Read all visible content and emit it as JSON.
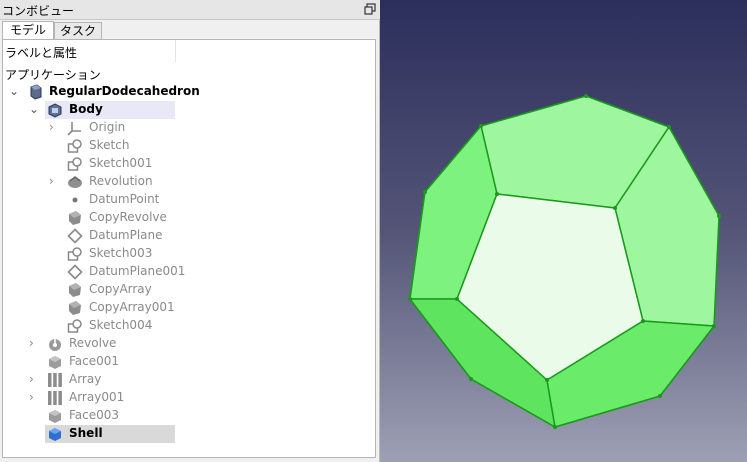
{
  "combo": {
    "title": "コンボビュー",
    "tabs": [
      {
        "label": "モデル"
      },
      {
        "label": "タスク"
      }
    ],
    "labels_header": "ラベルと属性",
    "app_header": "アプリケーション"
  },
  "tree": {
    "root": {
      "label": "RegularDodecahedron"
    },
    "items": [
      {
        "label": "Body"
      },
      {
        "label": "Origin"
      },
      {
        "label": "Sketch"
      },
      {
        "label": "Sketch001"
      },
      {
        "label": "Revolution"
      },
      {
        "label": "DatumPoint"
      },
      {
        "label": "CopyRevolve"
      },
      {
        "label": "DatumPlane"
      },
      {
        "label": "Sketch003"
      },
      {
        "label": "DatumPlane001"
      },
      {
        "label": "CopyArray"
      },
      {
        "label": "CopyArray001"
      },
      {
        "label": "Sketch004"
      },
      {
        "label": "Revolve"
      },
      {
        "label": "Face001"
      },
      {
        "label": "Array"
      },
      {
        "label": "Array001"
      },
      {
        "label": "Face003"
      },
      {
        "label": "Shell"
      }
    ]
  },
  "colors": {
    "selection_bg": "#e8e8f6",
    "shell_highlight": "#d9d9d9",
    "face_light": "#9ef79e",
    "face_mid": "#74ee74",
    "face_front": "#eafbea",
    "edge": "#1a9a1a"
  }
}
